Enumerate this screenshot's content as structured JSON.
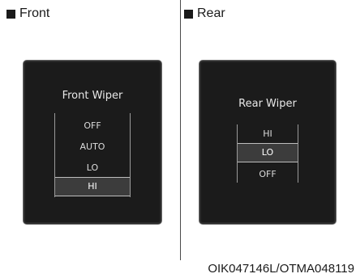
{
  "front": {
    "header": "Front",
    "title": "Front Wiper",
    "options": [
      "OFF",
      "AUTO",
      "LO",
      "HI"
    ],
    "selected": "HI"
  },
  "rear": {
    "header": "Rear",
    "title": "Rear Wiper",
    "options": [
      "HI",
      "LO",
      "OFF"
    ],
    "selected": "LO"
  },
  "figure_code": "OIK047146L/OTMA048119"
}
